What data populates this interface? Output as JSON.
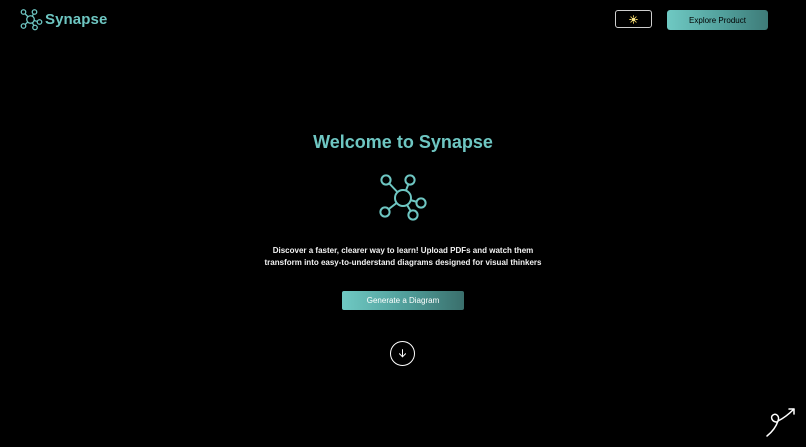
{
  "header": {
    "logo_text": "Synapse",
    "logo_icon": "network-nodes-icon",
    "theme_toggle_icon": "sun-icon",
    "explore_label": "Explore Product"
  },
  "hero": {
    "title": "Welcome to Synapse",
    "icon": "network-nodes-icon",
    "description": "Discover a faster, clearer way to learn! Upload PDFs and watch them transform into easy-to-understand diagrams designed for visual thinkers",
    "cta_label": "Generate a Diagram",
    "scroll_icon": "arrow-down-circle-icon"
  },
  "corner_mark_icon": "signature-arrow-icon",
  "colors": {
    "background": "#000000",
    "accent": "#6ec6c2",
    "accent_dark": "#3e7b78",
    "text": "#f2f2f2"
  }
}
